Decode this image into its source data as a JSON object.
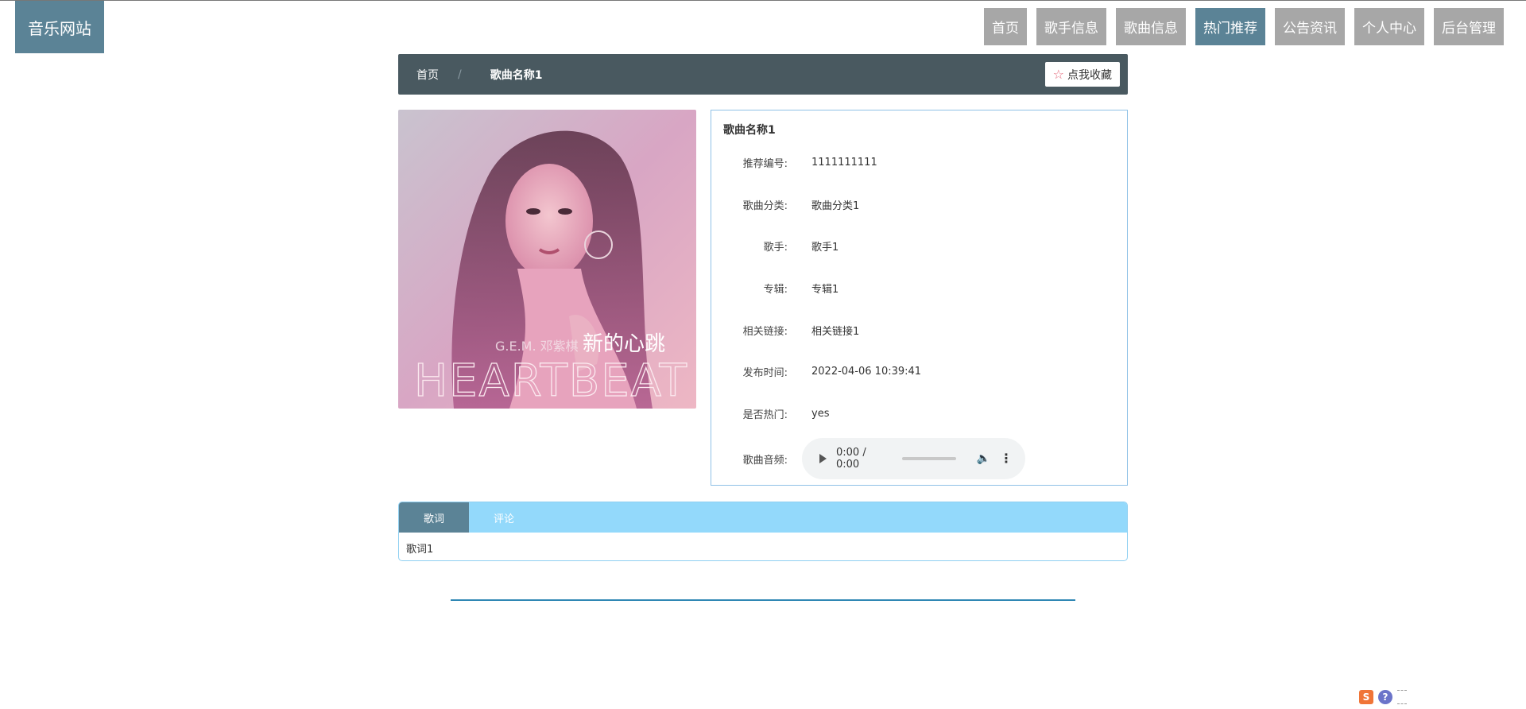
{
  "site": {
    "logo": "音乐网站"
  },
  "nav": {
    "items": [
      {
        "label": "首页"
      },
      {
        "label": "歌手信息"
      },
      {
        "label": "歌曲信息"
      },
      {
        "label": "热门推荐",
        "active": true
      },
      {
        "label": "公告资讯"
      },
      {
        "label": "个人中心"
      },
      {
        "label": "后台管理"
      }
    ]
  },
  "breadcrumb": {
    "home": "首页",
    "separator": "/",
    "current": "歌曲名称1"
  },
  "favorite": {
    "label": "点我收藏",
    "icon": "star-outline-icon"
  },
  "cover": {
    "text_name": "新的心跳",
    "text_artist": "G.E.M. 邓紫棋",
    "text_title": "HEARTBEAT"
  },
  "detail": {
    "title": "歌曲名称1",
    "fields": [
      {
        "label": "推荐编号:",
        "value": "1111111111"
      },
      {
        "label": "歌曲分类:",
        "value": "歌曲分类1"
      },
      {
        "label": "歌手:",
        "value": "歌手1"
      },
      {
        "label": "专辑:",
        "value": "专辑1"
      },
      {
        "label": "相关链接:",
        "value": "相关链接1"
      },
      {
        "label": "发布时间:",
        "value": "2022-04-06 10:39:41"
      },
      {
        "label": "是否热门:",
        "value": "yes"
      }
    ],
    "audio_label": "歌曲音频:",
    "audio_time": "0:00 / 0:00"
  },
  "tabs": {
    "items": [
      {
        "label": "歌词",
        "active": true
      },
      {
        "label": "评论"
      }
    ],
    "content": "歌词1"
  },
  "colors": {
    "accent": "#5b8396",
    "nav_inactive": "#a7a7a7",
    "crumb_bg": "#495960",
    "tab_bar": "#93d9fb",
    "footer_line": "#2f87b4"
  }
}
